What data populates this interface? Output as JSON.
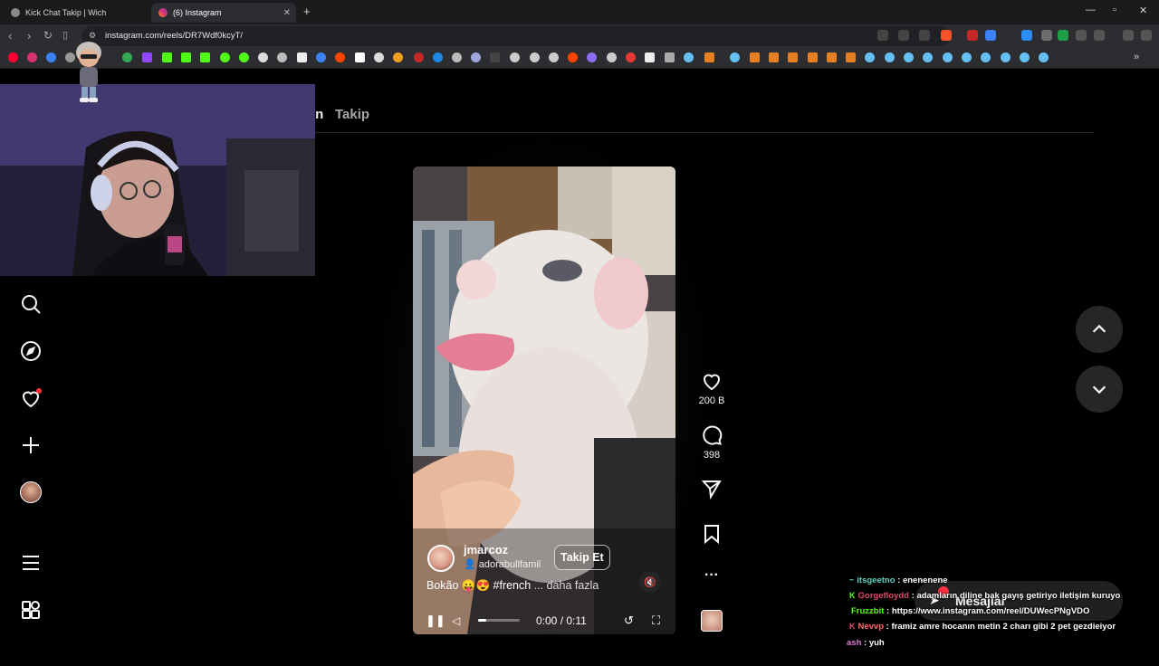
{
  "browser": {
    "tabs": [
      {
        "title": "Kick Chat Takip | Wich",
        "active": false
      },
      {
        "title": "(6) Instagram",
        "active": true
      }
    ],
    "address": "instagram.com/reels/DR7Wdf0kcyT/"
  },
  "instagram": {
    "header_tabs": [
      {
        "label": "in"
      },
      {
        "label": "Takip"
      }
    ],
    "reel": {
      "username": "jmarcoz",
      "collaborator": "adorabullfamil",
      "follow_label": "Takip Et",
      "caption_text": "Bokão 😛😍 #french",
      "caption_more": "... daha fazla",
      "time": "0:00 / 0:11",
      "progress_fraction": 0.2
    },
    "actions": {
      "likes": "200 B",
      "comments": "398"
    },
    "messages_label": "Mesajlar"
  },
  "chat": [
    {
      "user": "itsgeetno",
      "text": "enenenene",
      "color": "#5fd3c4",
      "badge": "~"
    },
    {
      "user": "Gorgefloydd",
      "text": "adamların diline bak gayış getiriyo iletişim kuruyo",
      "color": "#e0486a",
      "badge": "K"
    },
    {
      "user": "Fruzzbit",
      "text": "https://www.instagram.com/reel/DUWecPNgVDO",
      "color": "#53fc18",
      "badge": ""
    },
    {
      "user": "Nevvp",
      "text": "framiz amre hocanın metin 2 charı gibi 2 pet gezdieiyor",
      "color": "#ff6b6b",
      "badge": "K"
    },
    {
      "user": "ash",
      "text": "yuh",
      "color": "#e07bd6",
      "badge": ""
    }
  ],
  "colors": {
    "accent": "#53fc18",
    "notification": "#ff3040"
  }
}
